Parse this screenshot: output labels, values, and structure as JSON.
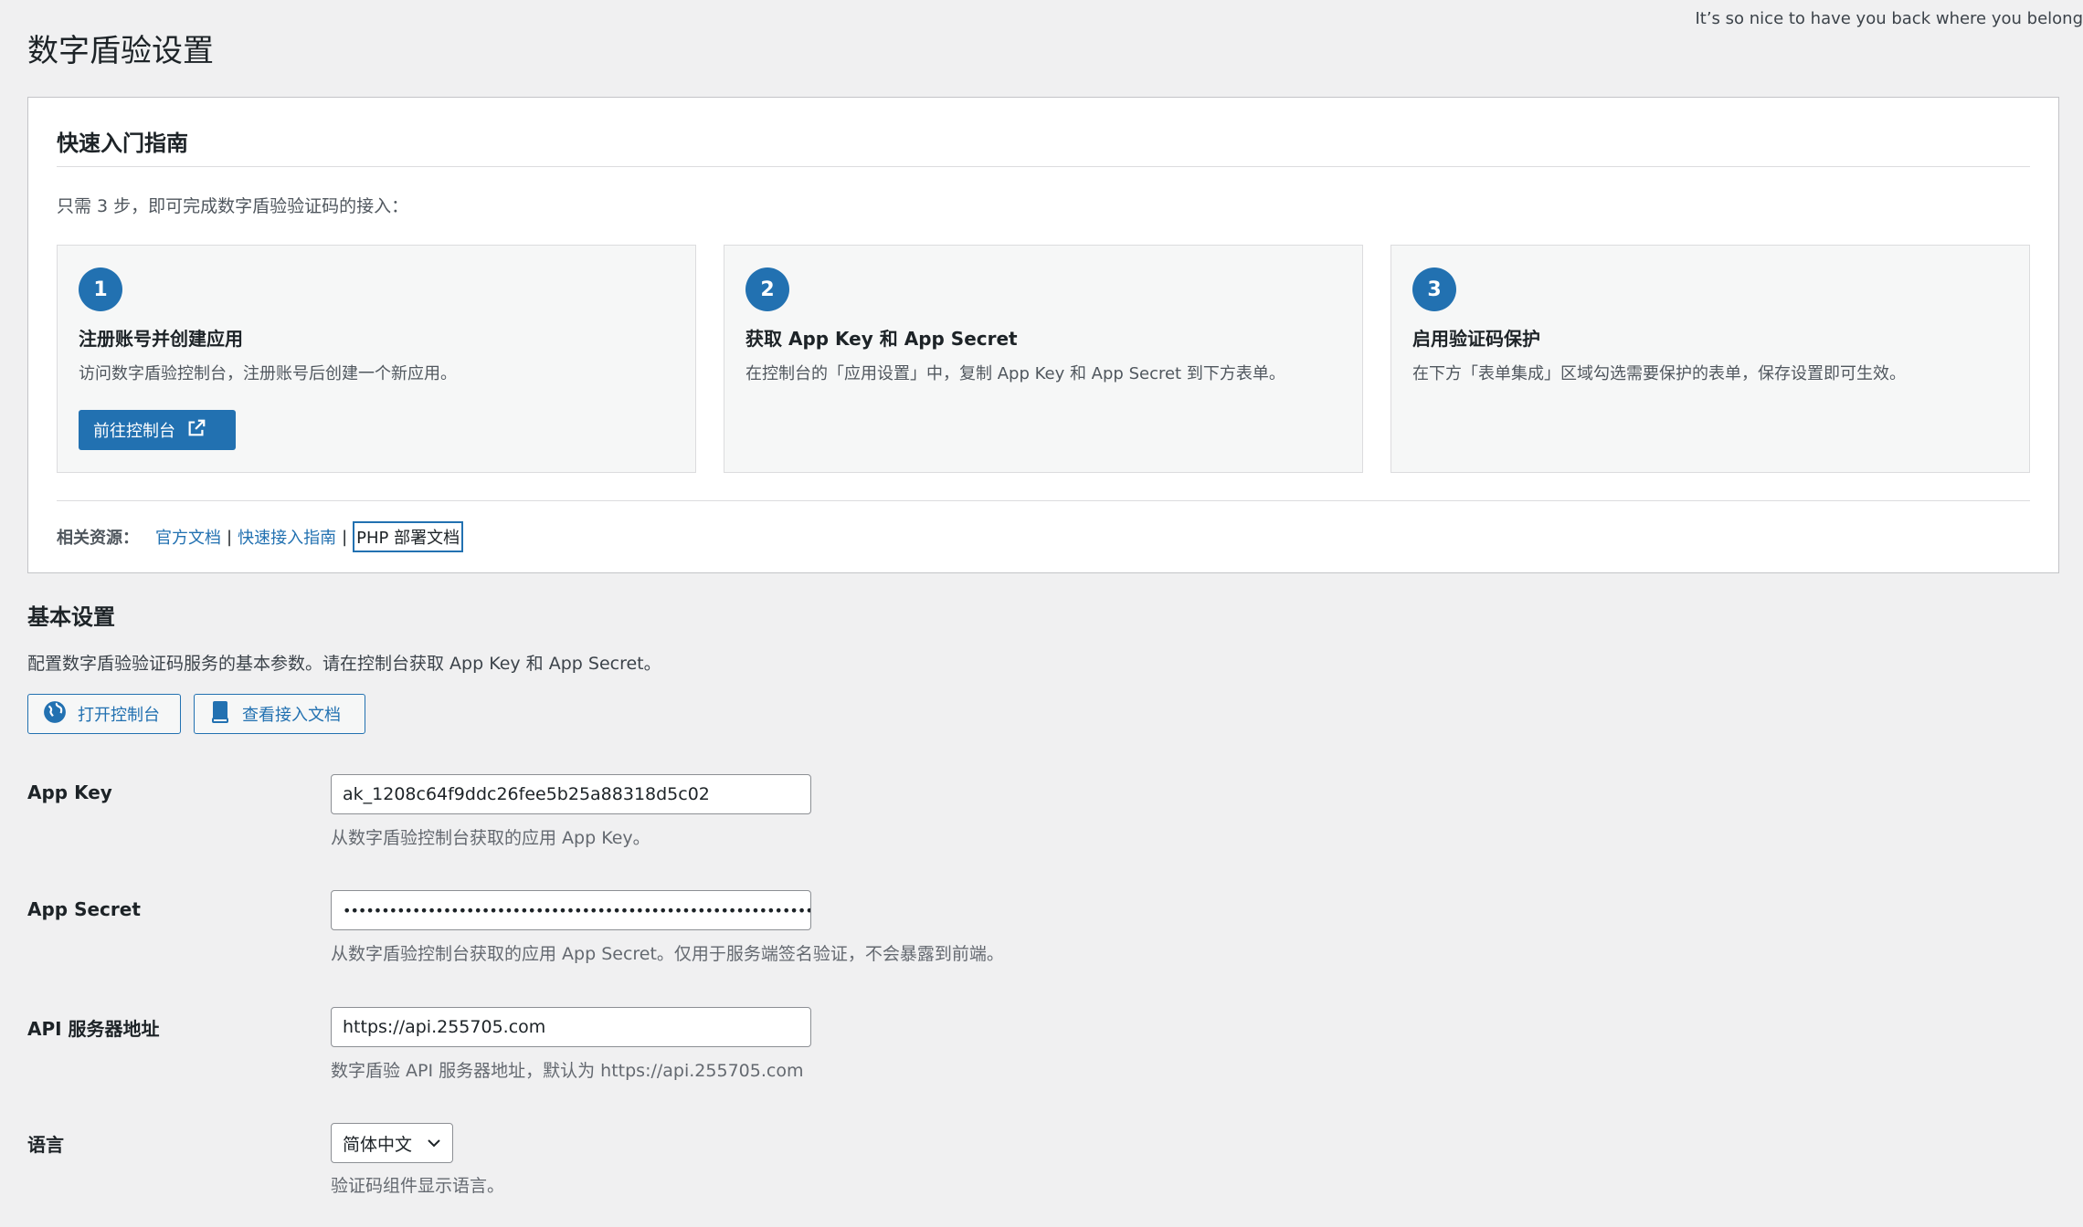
{
  "header": {
    "tagline": "It’s so nice to have you back where you belong",
    "page_title": "数字盾验设置"
  },
  "guide": {
    "title": "快速入门指南",
    "intro": "只需 3 步，即可完成数字盾验验证码的接入：",
    "steps": [
      {
        "num": "1",
        "title": "注册账号并创建应用",
        "desc": "访问数字盾验控制台，注册账号后创建一个新应用。",
        "button": "前往控制台"
      },
      {
        "num": "2",
        "title": "获取 App Key 和 App Secret",
        "desc": "在控制台的「应用设置」中，复制 App Key 和 App Secret 到下方表单。"
      },
      {
        "num": "3",
        "title": "启用验证码保护",
        "desc": "在下方「表单集成」区域勾选需要保护的表单，保存设置即可生效。"
      }
    ],
    "resources": {
      "label": "相关资源：",
      "links": [
        "官方文档",
        "快速接入指南",
        "PHP 部署文档"
      ],
      "separator": "|"
    }
  },
  "basic": {
    "title": "基本设置",
    "desc": "配置数字盾验验证码服务的基本参数。请在控制台获取 App Key 和 App Secret。",
    "buttons": {
      "open_console": "打开控制台",
      "view_docs": "查看接入文档"
    },
    "fields": {
      "app_key": {
        "label": "App Key",
        "value": "ak_1208c64f9ddc26fee5b25a88318d5c02",
        "help": "从数字盾验控制台获取的应用 App Key。"
      },
      "app_secret": {
        "label": "App Secret",
        "value": "•••••••••••••••••••••••••••••••••••••••••••••••••••••••••••••••",
        "help": "从数字盾验控制台获取的应用 App Secret。仅用于服务端签名验证，不会暴露到前端。"
      },
      "api_server": {
        "label": "API 服务器地址",
        "value": "https://api.255705.com",
        "help": "数字盾验 API 服务器地址，默认为 https://api.255705.com"
      },
      "language": {
        "label": "语言",
        "value": "简体中文",
        "help": "验证码组件显示语言。"
      }
    }
  },
  "colors": {
    "accent": "#2271b1",
    "background": "#f0f0f1"
  }
}
